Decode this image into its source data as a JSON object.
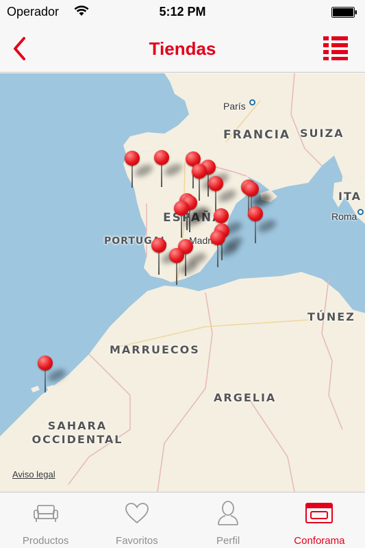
{
  "status_bar": {
    "carrier": "Operador",
    "time": "5:12 PM",
    "wifi_icon": "wifi-icon",
    "battery_icon": "battery-icon"
  },
  "nav": {
    "title": "Tiendas",
    "back_icon": "chevron-left-icon",
    "list_icon": "list-icon",
    "accent_color": "#e3001b"
  },
  "map": {
    "labels": {
      "francia": "FRANCIA",
      "suiza": "SUIZA",
      "italia": "ITA",
      "espana": "ESPAÑA",
      "portugal": "PORTUGAL",
      "tunez": "TÚNEZ",
      "marruecos": "MARRUECOS",
      "argelia": "ARGELIA",
      "sahara_line1": "SAHARA",
      "sahara_line2": "OCCIDENTAL"
    },
    "cities": {
      "paris": "París",
      "madrid": "Madrid",
      "roma": "Roma"
    },
    "legal": "Aviso legal",
    "pin_color": "#e4141b",
    "water_color": "#9ec6df",
    "land_color": "#f4efe1",
    "store_pin_count": 20
  },
  "tabs": [
    {
      "label": "Productos",
      "icon": "sofa-icon",
      "active": false
    },
    {
      "label": "Favoritos",
      "icon": "heart-icon",
      "active": false
    },
    {
      "label": "Perfil",
      "icon": "person-icon",
      "active": false
    },
    {
      "label": "Conforama",
      "icon": "store-icon",
      "active": true
    }
  ]
}
